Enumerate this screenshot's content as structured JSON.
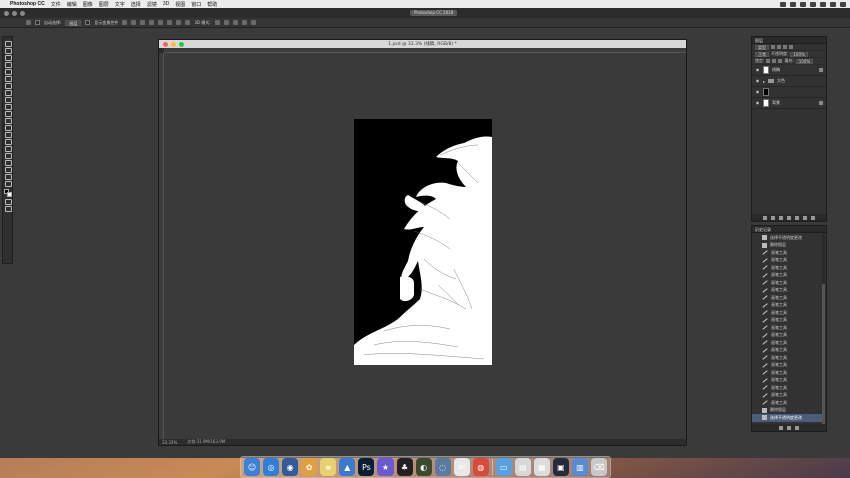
{
  "menubar": {
    "app_name": "Photoshop CC",
    "items": [
      "文件",
      "编辑",
      "图像",
      "图层",
      "文字",
      "选择",
      "滤镜",
      "3D",
      "视图",
      "窗口",
      "帮助"
    ]
  },
  "app": {
    "title": "Photoshop CC 2018"
  },
  "options_bar": {
    "auto_select_label": "自动选择:",
    "auto_select_value": "图层",
    "show_transform_label": "显示变换控件",
    "mode_label": "3D 模式:"
  },
  "document": {
    "title": "1.psd @ 33.3% (线稿, RGB/8) *",
    "zoom": "33.33%",
    "doc_size": "文档:31.9M/163.9M"
  },
  "layers_panel": {
    "title": "图层",
    "kind_label": "类型",
    "blend_mode": "正常",
    "opacity_label": "不透明度:",
    "opacity_value": "100%",
    "lock_label": "锁定:",
    "fill_label": "填充:",
    "fill_value": "100%",
    "layers": [
      {
        "name": "线稿",
        "thumb": "#ffffff",
        "locked": true
      },
      {
        "name": "大色",
        "thumb": "folder",
        "locked": false
      },
      {
        "name": "",
        "thumb": "#000000",
        "locked": false
      },
      {
        "name": "背景",
        "thumb": "#ffffff",
        "locked": true
      }
    ]
  },
  "history_panel": {
    "title": "历史记录",
    "items": [
      {
        "label": "选择不透明度更改",
        "icon": "doc"
      },
      {
        "label": "删除图层",
        "icon": "doc"
      },
      {
        "label": "画笔工具",
        "icon": "brush"
      },
      {
        "label": "画笔工具",
        "icon": "brush"
      },
      {
        "label": "画笔工具",
        "icon": "brush"
      },
      {
        "label": "画笔工具",
        "icon": "brush"
      },
      {
        "label": "画笔工具",
        "icon": "brush"
      },
      {
        "label": "画笔工具",
        "icon": "brush"
      },
      {
        "label": "画笔工具",
        "icon": "brush"
      },
      {
        "label": "画笔工具",
        "icon": "brush"
      },
      {
        "label": "画笔工具",
        "icon": "brush"
      },
      {
        "label": "画笔工具",
        "icon": "brush"
      },
      {
        "label": "画笔工具",
        "icon": "brush"
      },
      {
        "label": "画笔工具",
        "icon": "brush"
      },
      {
        "label": "画笔工具",
        "icon": "brush"
      },
      {
        "label": "画笔工具",
        "icon": "brush"
      },
      {
        "label": "画笔工具",
        "icon": "brush"
      },
      {
        "label": "画笔工具",
        "icon": "brush"
      },
      {
        "label": "画笔工具",
        "icon": "brush"
      },
      {
        "label": "画笔工具",
        "icon": "brush"
      },
      {
        "label": "画笔工具",
        "icon": "brush"
      },
      {
        "label": "画笔工具",
        "icon": "brush"
      },
      {
        "label": "画笔工具",
        "icon": "brush"
      },
      {
        "label": "删除图层",
        "icon": "doc"
      },
      {
        "label": "选择不透明度更改",
        "icon": "doc",
        "selected": true
      }
    ]
  },
  "dock": {
    "apps": [
      {
        "name": "finder-icon",
        "color": "#3b82d6",
        "glyph": "☺"
      },
      {
        "name": "safari-icon",
        "color": "#2f7fd8",
        "glyph": "◎"
      },
      {
        "name": "chrome-alt-icon",
        "color": "#335b9a",
        "glyph": "◉"
      },
      {
        "name": "photos-icon",
        "color": "#e0a040",
        "glyph": "✿"
      },
      {
        "name": "notes-icon",
        "color": "#e8d070",
        "glyph": "≡"
      },
      {
        "name": "keynote-icon",
        "color": "#3a7ad0",
        "glyph": "▲"
      },
      {
        "name": "photoshop-icon",
        "color": "#0b1e33",
        "glyph": "Ps"
      },
      {
        "name": "imovie-icon",
        "color": "#6a5ad0",
        "glyph": "★"
      },
      {
        "name": "qq-icon",
        "color": "#222222",
        "glyph": "♣"
      },
      {
        "name": "wacom-icon",
        "color": "#3a4a2a",
        "glyph": "◐"
      },
      {
        "name": "quicktime-icon",
        "color": "#5a7aa0",
        "glyph": "◌"
      },
      {
        "name": "wechat-icon",
        "color": "#e8e8e8",
        "glyph": "✉"
      },
      {
        "name": "chrome-icon",
        "color": "#d84a3a",
        "glyph": "◍"
      },
      {
        "name": "folder-icon",
        "color": "#5aa0e0",
        "glyph": "▭"
      },
      {
        "name": "preview-icon",
        "color": "#d8d8d8",
        "glyph": "▤"
      },
      {
        "name": "screenshot-icon",
        "color": "#dcdcdc",
        "glyph": "▦"
      },
      {
        "name": "monitor-icon",
        "color": "#222c3a",
        "glyph": "▣"
      },
      {
        "name": "downloads-icon",
        "color": "#5a8ad0",
        "glyph": "▥"
      },
      {
        "name": "trash-icon",
        "color": "#c8c8c8",
        "glyph": "⌫"
      }
    ]
  }
}
